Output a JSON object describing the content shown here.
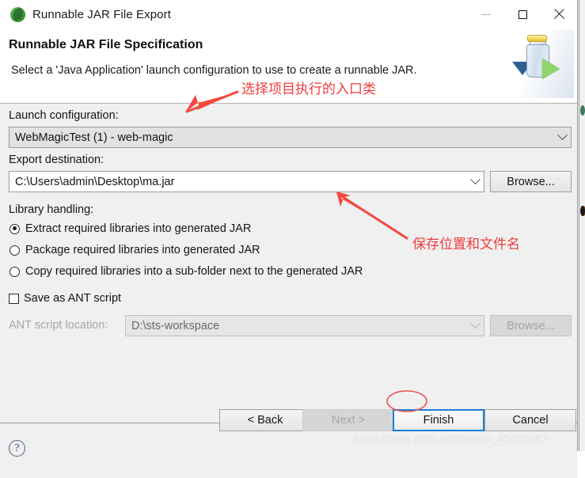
{
  "window": {
    "title": "Runnable JAR File Export",
    "icon": "eclipse-leaf-icon",
    "controls": {
      "minimize": "minimize-icon",
      "maximize": "maximize-icon",
      "close": "close-icon"
    }
  },
  "header": {
    "title": "Runnable JAR File Specification",
    "description": "Select a 'Java Application' launch configuration to use to create a runnable JAR.",
    "banner_icon": "jar-export-icon"
  },
  "form": {
    "launch_configuration": {
      "label": "Launch configuration:",
      "value": "WebMagicTest (1) - web-magic"
    },
    "export_destination": {
      "label": "Export destination:",
      "value": "C:\\Users\\admin\\Desktop\\ma.jar",
      "browse_label": "Browse..."
    },
    "library_handling": {
      "label": "Library handling:",
      "options": [
        {
          "label": "Extract required libraries into generated JAR",
          "selected": true
        },
        {
          "label": "Package required libraries into generated JAR",
          "selected": false
        },
        {
          "label": "Copy required libraries into a sub-folder next to the generated JAR",
          "selected": false
        }
      ]
    },
    "ant": {
      "checkbox_label": "Save as ANT script",
      "checked": false,
      "location_label": "ANT script location:",
      "location_value": "D:\\sts-workspace",
      "browse_label": "Browse..."
    }
  },
  "footer": {
    "help_icon": "help-question-icon",
    "buttons": [
      {
        "label": "< Back",
        "state": "enabled",
        "name": "back-button"
      },
      {
        "label": "Next >",
        "state": "disabled",
        "name": "next-button"
      },
      {
        "label": "Finish",
        "state": "focused",
        "name": "finish-button"
      },
      {
        "label": "Cancel",
        "state": "enabled",
        "name": "cancel-button"
      }
    ]
  },
  "annotations": {
    "note_launch_config": "选择项目执行的入口类",
    "note_export_destination": "保存位置和文件名",
    "color": "#ef3b3b"
  },
  "watermark": {
    "text": "https://blog.csdn.net/weixin_45059962"
  }
}
